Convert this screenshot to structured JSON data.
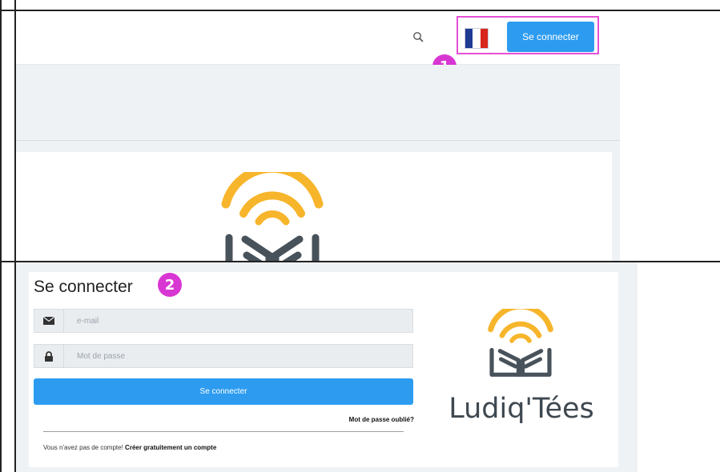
{
  "top_panel": {
    "header": {
      "search_icon": "search-icon",
      "language": "French",
      "flag_colors": [
        "#1f3a93",
        "#ffffff",
        "#d7261e"
      ],
      "login_button": "Se connecter",
      "login_button_color": "#2d9cf0"
    },
    "callout_1": "1",
    "callout_color": "#d836d3",
    "highlight_color": "#e64fd6"
  },
  "login_panel": {
    "title": "Se connecter",
    "callout_2": "2",
    "email_icon": "envelope-icon",
    "email_placeholder": "e-mail",
    "password_icon": "lock-icon",
    "password_placeholder": "Mot de passe",
    "submit_label": "Se connecter",
    "forgot_link": "Mot de passe oublié?",
    "no_account_text": "Vous n'avez pas de compte!",
    "signup_link": "Créer gratuitement un compte",
    "brand_name": "Ludiq'Tées",
    "brand_icon": "book-wifi-logo",
    "brand_colors": {
      "arcs": "#f7b52b",
      "book": "#48525b"
    }
  }
}
